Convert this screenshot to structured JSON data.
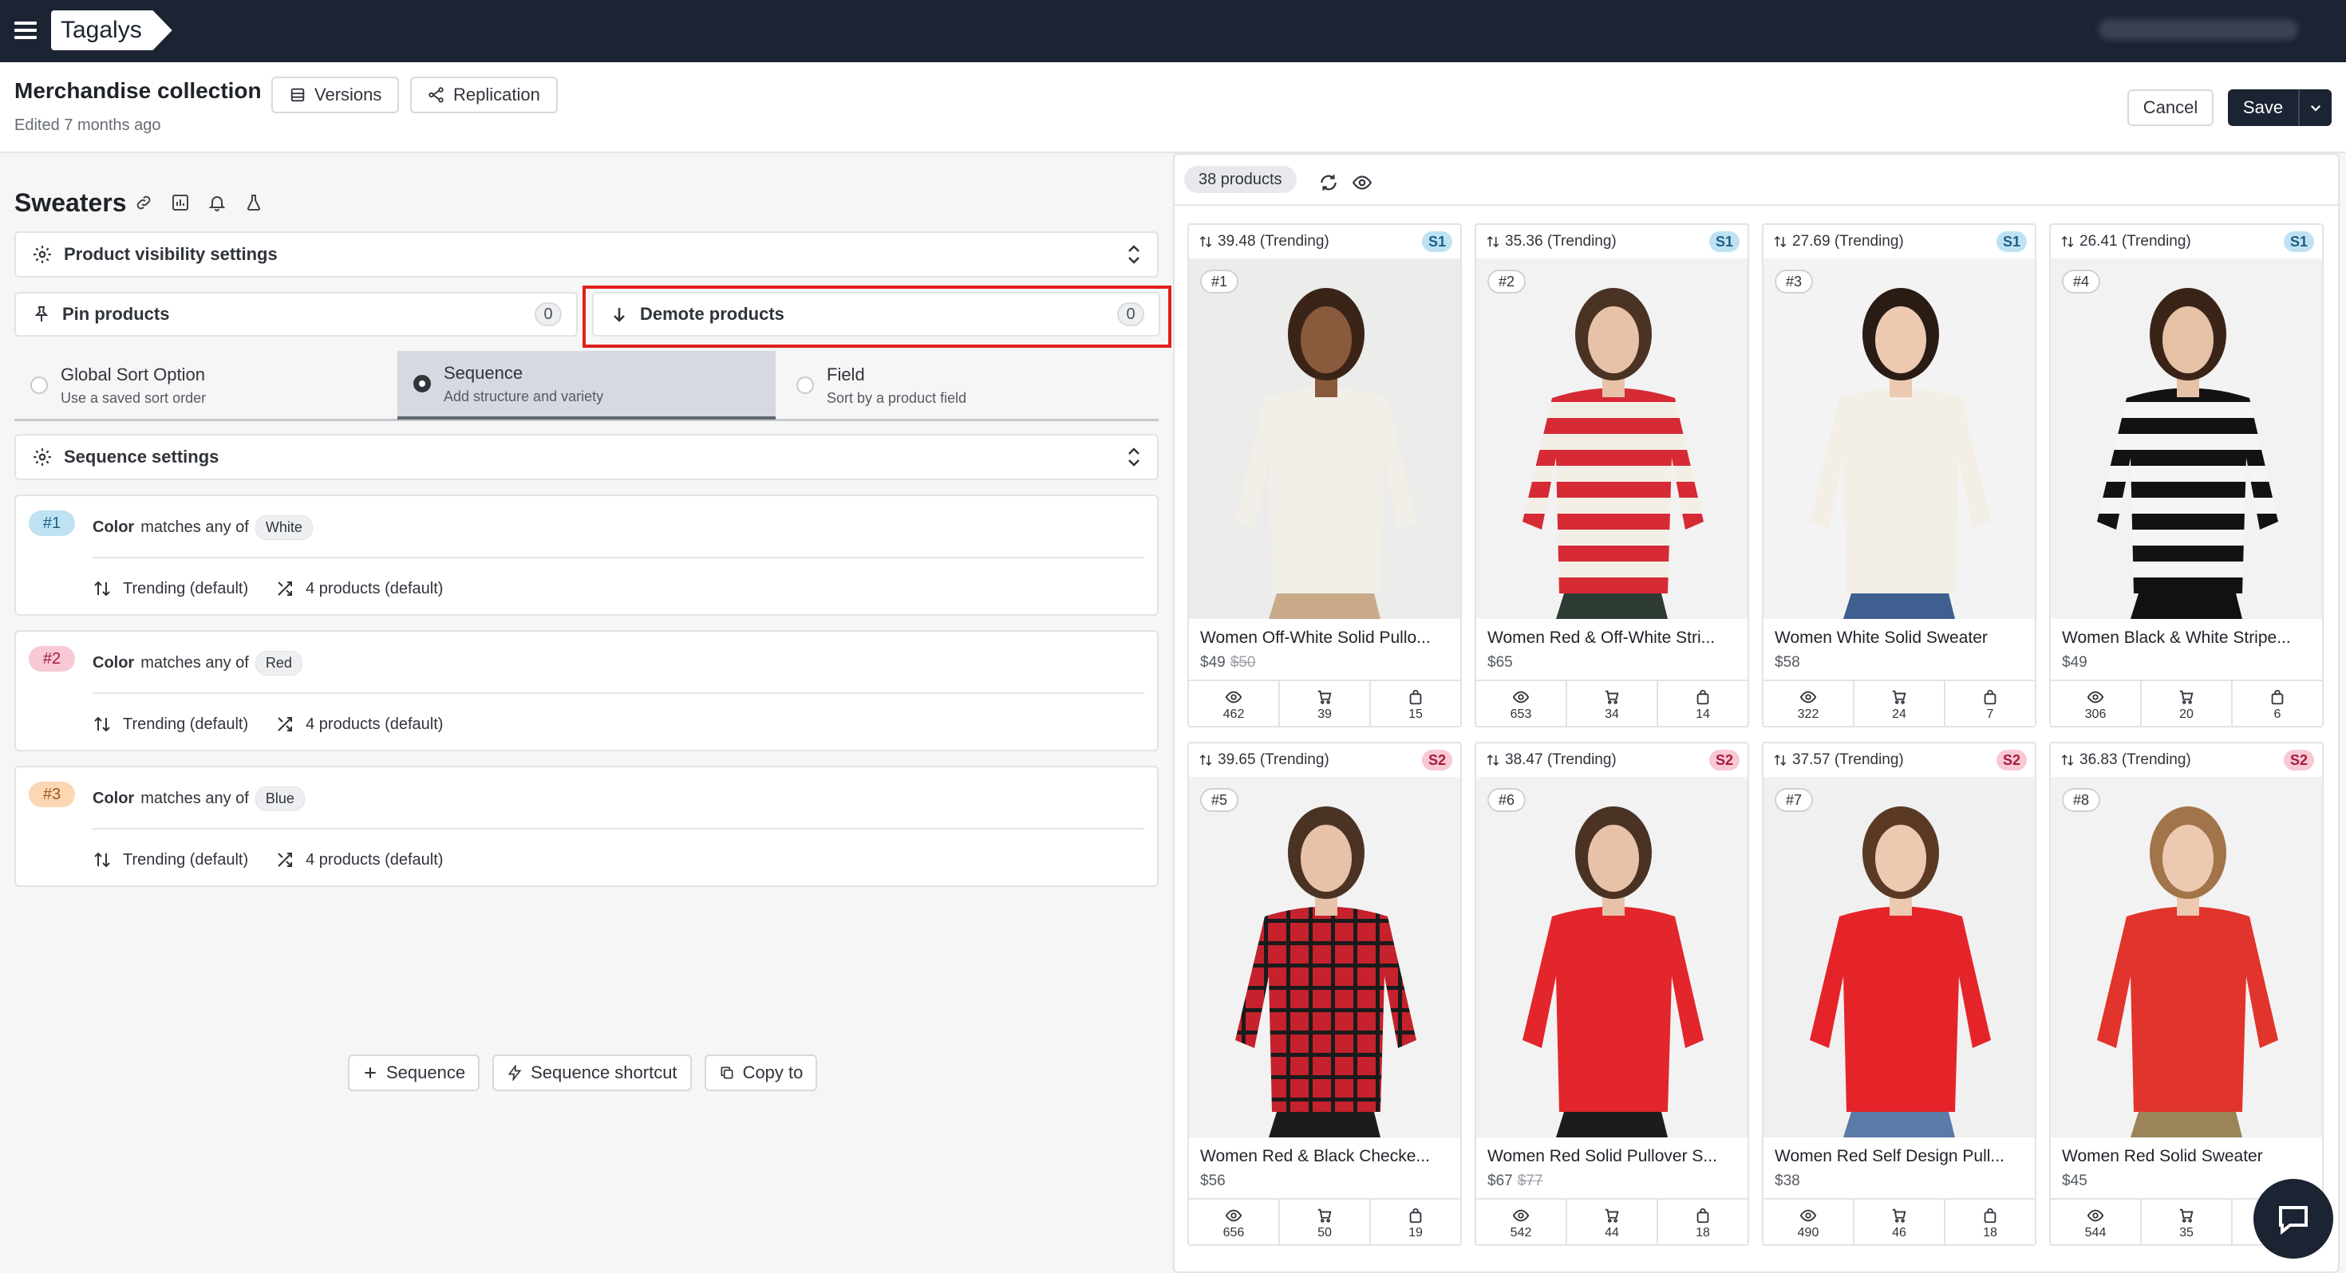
{
  "topbar": {
    "logo": "Tagalys"
  },
  "header": {
    "title": "Merchandise collection",
    "subtitle": "Edited 7 months ago",
    "versions_label": "Versions",
    "replication_label": "Replication",
    "cancel_label": "Cancel",
    "save_label": "Save"
  },
  "category": {
    "title": "Sweaters"
  },
  "panels": {
    "visibility_label": "Product visibility settings",
    "pin_label": "Pin products",
    "pin_count": "0",
    "demote_label": "Demote products",
    "demote_count": "0",
    "sequence_settings_label": "Sequence settings"
  },
  "tabs": [
    {
      "title": "Global Sort Option",
      "desc": "Use a saved sort order"
    },
    {
      "title": "Sequence",
      "desc": "Add structure and variety"
    },
    {
      "title": "Field",
      "desc": "Sort by a product field"
    }
  ],
  "rules": [
    {
      "num": "#1",
      "field": "Color",
      "op": "matches any of",
      "value": "White",
      "sort": "Trending (default)",
      "count": "4 products (default)",
      "color_bg": "#bfe2f3",
      "color_fg": "#1f5f85"
    },
    {
      "num": "#2",
      "field": "Color",
      "op": "matches any of",
      "value": "Red",
      "sort": "Trending (default)",
      "count": "4 products (default)",
      "color_bg": "#f8c8d4",
      "color_fg": "#a41c3d"
    },
    {
      "num": "#3",
      "field": "Color",
      "op": "matches any of",
      "value": "Blue",
      "sort": "Trending (default)",
      "count": "4 products (default)",
      "color_bg": "#fbd7b4",
      "color_fg": "#a2561a"
    }
  ],
  "actions": {
    "sequence_label": "Sequence",
    "shortcut_label": "Sequence shortcut",
    "copy_label": "Copy to"
  },
  "products_panel": {
    "count_label": "38 products"
  },
  "products": [
    {
      "score": "39.48 (Trending)",
      "seg": "S1",
      "rank": "#1",
      "name": "Women Off-White Solid Pullo...",
      "price": "$49",
      "old_price": "$50",
      "views": "462",
      "carts": "39",
      "orders": "15",
      "sweater": "#f1efe8",
      "bg": "#ececea",
      "skin": "#8a5a3c",
      "hair": "#3a2418",
      "bottom": "#c9ab8a"
    },
    {
      "score": "35.36 (Trending)",
      "seg": "S1",
      "rank": "#2",
      "name": "Women Red & Off-White Stri...",
      "price": "$65",
      "old_price": "",
      "views": "653",
      "carts": "34",
      "orders": "14",
      "sweater": "#d62a35",
      "stripe": "#f4efe6",
      "bg": "#f2f2f2",
      "skin": "#e8c2a8",
      "hair": "#4a3324",
      "bottom": "#2e3b32"
    },
    {
      "score": "27.69 (Trending)",
      "seg": "S1",
      "rank": "#3",
      "name": "Women White Solid Sweater",
      "price": "$58",
      "old_price": "",
      "views": "322",
      "carts": "24",
      "orders": "7",
      "sweater": "#f4efe6",
      "bg": "#f3f3f3",
      "skin": "#ecc9b0",
      "hair": "#2a1b14",
      "bottom": "#3e5f8f"
    },
    {
      "score": "26.41 (Trending)",
      "seg": "S1",
      "rank": "#4",
      "name": "Women Black & White Stripe...",
      "price": "$49",
      "old_price": "",
      "views": "306",
      "carts": "20",
      "orders": "6",
      "sweater": "#121212",
      "stripe": "#f5f5f5",
      "bg": "#f2f2f2",
      "skin": "#e7c1a6",
      "hair": "#3a2418",
      "bottom": "#111"
    },
    {
      "score": "39.65 (Trending)",
      "seg": "S2",
      "rank": "#5",
      "name": "Women Red & Black Checke...",
      "price": "$56",
      "old_price": "",
      "views": "656",
      "carts": "50",
      "orders": "19",
      "sweater": "#c5222d",
      "check": "#1b1b1b",
      "bg": "#f2f2f2",
      "skin": "#e8c2a8",
      "hair": "#4a3324",
      "bottom": "#1c1c1c"
    },
    {
      "score": "38.47 (Trending)",
      "seg": "S2",
      "rank": "#6",
      "name": "Women Red Solid Pullover S...",
      "price": "$67",
      "old_price": "$77",
      "views": "542",
      "carts": "44",
      "orders": "18",
      "sweater": "#e2262c",
      "bg": "#f2f2f2",
      "skin": "#e8c2a8",
      "hair": "#4a3324",
      "bottom": "#1c1c1c"
    },
    {
      "score": "37.57 (Trending)",
      "seg": "S2",
      "rank": "#7",
      "name": "Women Red Self Design Pull...",
      "price": "$38",
      "old_price": "",
      "views": "490",
      "carts": "46",
      "orders": "18",
      "sweater": "#e5242a",
      "bg": "#f0f0f0",
      "skin": "#ecc9b0",
      "hair": "#5a3a25",
      "bottom": "#5a7aa8"
    },
    {
      "score": "36.83 (Trending)",
      "seg": "S2",
      "rank": "#8",
      "name": "Women Red Solid Sweater",
      "price": "$45",
      "old_price": "",
      "views": "544",
      "carts": "35",
      "orders": "",
      "sweater": "#e1342c",
      "bg": "#f2f2f2",
      "skin": "#ecc9b0",
      "hair": "#a2744a",
      "bottom": "#9a8458"
    }
  ]
}
